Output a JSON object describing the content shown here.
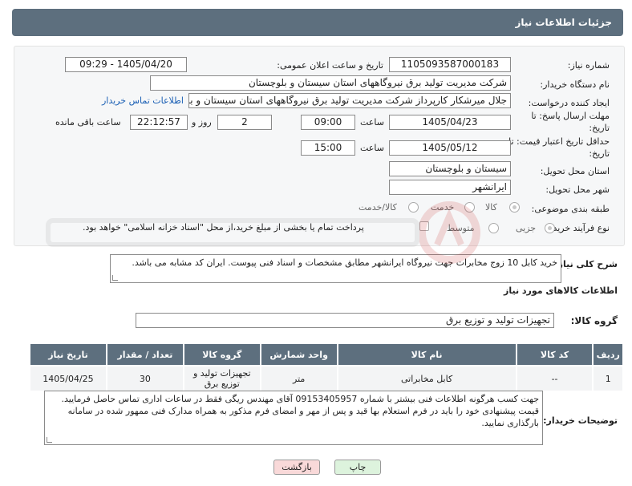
{
  "header": {
    "title": "جزئیات اطلاعات نیاز"
  },
  "form": {
    "need_number_label": "شماره نیاز:",
    "need_number": "1105093587000183",
    "announce_label": "تاریخ و ساعت اعلان عمومی:",
    "announce_value": "1405/04/20 - 09:29",
    "buyer_org_label": "نام دستگاه خریدار:",
    "buyer_org": "شرکت مدیریت تولید برق نیروگاههای استان سیستان و بلوچستان",
    "requester_label": "ایجاد کننده درخواست:",
    "requester": "جلال میرشکار کارپرداز شرکت مدیریت تولید برق نیروگاههای استان سیستان و با",
    "buyer_contact_link": "اطلاعات تماس خریدار",
    "reply_deadline_label": "مهلت ارسال پاسخ: تا تاریخ:",
    "reply_date": "1405/04/23",
    "time_word": "ساعت",
    "reply_time": "09:00",
    "days_value": "2",
    "days_word": "روز و",
    "remaining_value": "22:12:57",
    "remaining_word": "ساعت باقی مانده",
    "price_deadline_label": "حداقل تاریخ اعتبار قیمت: تا تاریخ:",
    "price_date": "1405/05/12",
    "price_time": "15:00",
    "province_label": "استان محل تحویل:",
    "province": "سیستان و بلوچستان",
    "city_label": "شهر محل تحویل:",
    "city": "ایرانشهر",
    "category_label": "طبقه بندی موضوعی:",
    "category_options": [
      "کالا",
      "خدمت",
      "کالا/خدمت"
    ],
    "process_label": "نوع فرآیند خرید :",
    "process_options": [
      "جزیی",
      "متوسط"
    ],
    "payment_note": "پرداخت تمام یا بخشی از مبلغ خرید،از محل \"اسناد خزانه اسلامی\" خواهد بود."
  },
  "summary": {
    "label": "شرح کلی نیاز:",
    "text": "خرید کابل 10 زوج مخابرات جهت نیروگاه ایرانشهر مطابق مشخصات و اسناد فنی پیوست. ایران کد مشابه می باشد."
  },
  "goods": {
    "section_title": "اطلاعات کالاهای مورد نیاز",
    "group_label": "گروه کالا:",
    "group_value": "تجهیزات تولید و توزیع برق",
    "columns": [
      "ردیف",
      "کد کالا",
      "نام کالا",
      "واحد شمارش",
      "گروه کالا",
      "تعداد / مقدار",
      "تاریخ نیاز"
    ],
    "rows": [
      {
        "row": "1",
        "code": "--",
        "name": "کابل مخابراتی",
        "unit": "متر",
        "group": "تجهیزات تولید و توزیع برق",
        "qty": "30",
        "date": "1405/04/25"
      }
    ]
  },
  "buyer_notes": {
    "label": "توضیحات خریدار:",
    "text": "جهت کسب هرگونه اطلاعات فنی بیشتر با شماره 09153405957 آقای مهندس ریگی فقط در ساعات اداری تماس حاصل فرمایید. قیمت پیشنهادی خود را باید در فرم استعلام بها قید و پس از مهر و امضای فرم مذکور به همراه مدارک فنی ممهور شده در سامانه بارگذاری نمایید."
  },
  "buttons": {
    "print": "چاپ",
    "back": "بازگشت"
  },
  "colors": {
    "header_bg": "#5d6f7e",
    "back_btn_bg": "#f9d9d9",
    "print_btn_bg": "#ddf3dd",
    "link": "#1a5fb4"
  }
}
